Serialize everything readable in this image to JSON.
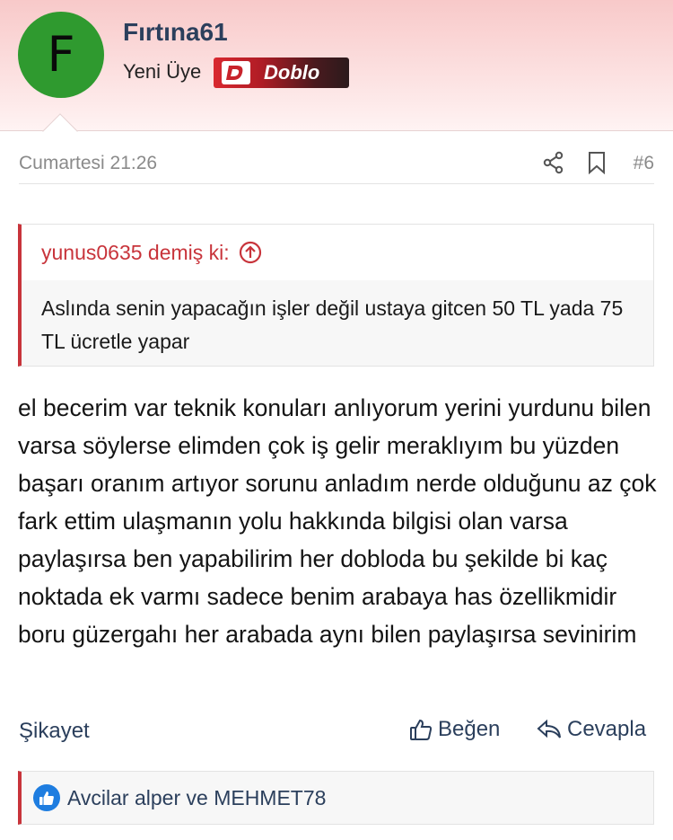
{
  "user": {
    "avatar_letter": "F",
    "avatar_color": "#2f9a2f",
    "name": "Fırtına61",
    "title": "Yeni Üye",
    "badge_label": "Doblo",
    "badge_icon": "doblo-logo-icon"
  },
  "meta": {
    "date": "Cumartesi 21:26",
    "post_number": "#6",
    "share_icon": "share-icon",
    "bookmark_icon": "bookmark-icon"
  },
  "quote": {
    "header": "yunus0635 demiş ki:",
    "body": "Aslında senin yapacağın işler değil ustaya gitcen 50 TL yada 75 TL ücretle yapar",
    "accent_color": "#c8343b"
  },
  "message": {
    "text": "el becerim var teknik konuları anlıyorum yerini yurdunu bilen varsa söylerse elimden çok iş gelir meraklıyım bu yüzden başarı oranım artıyor sorunu anladım nerde olduğunu az çok fark ettim ulaşmanın yolu hakkında bilgisi olan varsa paylaşırsa ben yapabilirim her dobloda bu şekilde bi kaç noktada ek varmı sadece benim arabaya has özellikmidir boru güzergahı her arabada aynı bilen paylaşırsa sevinirim"
  },
  "actions": {
    "report_label": "Şikayet",
    "like_label": "Beğen",
    "reply_label": "Cevapla"
  },
  "reactions": {
    "text": "Avcilar alper ve MEHMET78",
    "icon_color": "#1e7de0"
  }
}
